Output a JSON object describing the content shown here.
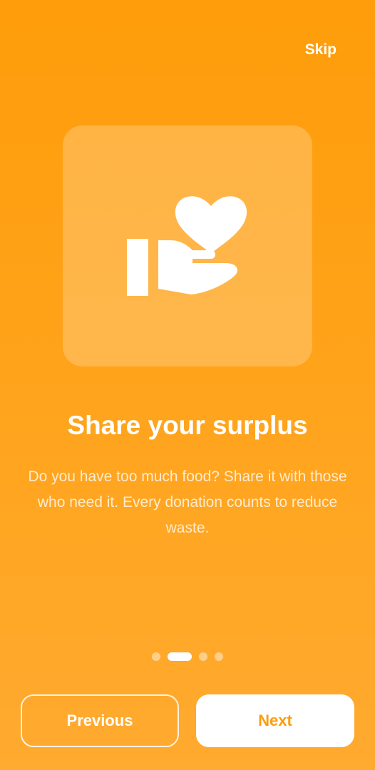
{
  "header": {
    "skip_label": "Skip"
  },
  "hero": {
    "icon": "hand-holding-heart-icon"
  },
  "content": {
    "title": "Share your surplus",
    "description": "Do you have too much food? Share it with those who need it. Every donation counts to reduce waste."
  },
  "pagination": {
    "total": 4,
    "current": 2
  },
  "footer": {
    "previous_label": "Previous",
    "next_label": "Next"
  },
  "colors": {
    "accent": "#FF9D0A",
    "background_top": "#FF9D0A",
    "background_bottom": "#FFAA30"
  }
}
